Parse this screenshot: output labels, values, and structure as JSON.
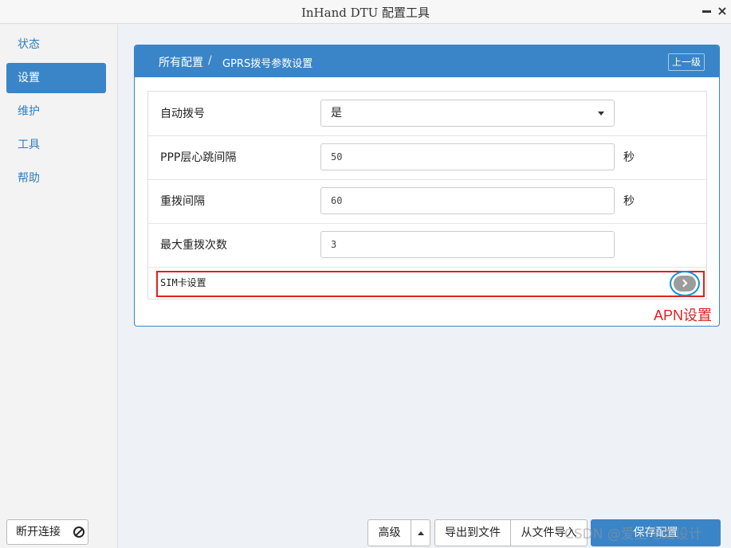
{
  "window": {
    "title": "InHand DTU 配置工具",
    "close_symbol": "×"
  },
  "sidebar": {
    "items": [
      {
        "label": "状态",
        "active": false
      },
      {
        "label": "设置",
        "active": true
      },
      {
        "label": "维护",
        "active": false
      },
      {
        "label": "工具",
        "active": false
      },
      {
        "label": "帮助",
        "active": false
      }
    ],
    "disconnect_label": "断开连接"
  },
  "panel": {
    "breadcrumb": {
      "home": "所有配置",
      "separator": "/",
      "current": "GPRS拨号参数设置"
    },
    "up_button": "上一级",
    "fields": [
      {
        "label": "自动拨号",
        "type": "select",
        "value": "是",
        "unit": ""
      },
      {
        "label": "PPP层心跳间隔",
        "type": "input",
        "value": "50",
        "unit": "秒"
      },
      {
        "label": "重拨间隔",
        "type": "input",
        "value": "60",
        "unit": "秒"
      },
      {
        "label": "最大重拨次数",
        "type": "input",
        "value": "3",
        "unit": ""
      }
    ],
    "sim_row_label": "SIM卡设置"
  },
  "annotation": {
    "apn_label": "APN设置",
    "highlight_color": "#e02020",
    "ring_color": "#1a8fd8"
  },
  "bottom_bar": {
    "advanced": "高级",
    "export": "导出到文件",
    "import": "从文件导入",
    "save": "保存配置"
  },
  "watermark": "CSDN @爱上电路设计",
  "colors": {
    "accent": "#3a85c8"
  }
}
